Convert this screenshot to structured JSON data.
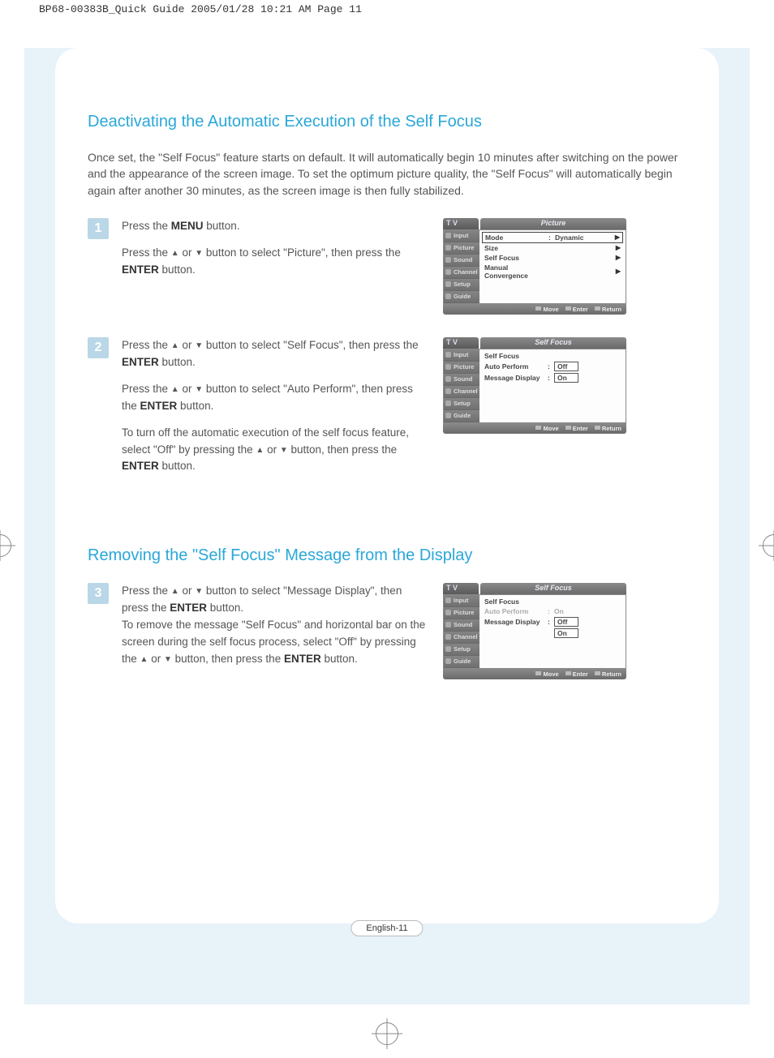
{
  "header": "BP68-00383B_Quick Guide  2005/01/28  10:21 AM  Page 11",
  "page_number": "English-11",
  "section1": {
    "title": "Deactivating the Automatic Execution of the Self Focus",
    "intro": "Once set, the \"Self Focus\" feature starts on default. It will automatically begin 10 minutes after switching on the power and the appearance of the screen image. To set the optimum picture quality, the \"Self Focus\" will automatically begin again after another 30 minutes, as the screen image is then fully stabilized.",
    "steps": [
      {
        "num": "1",
        "paras": [
          "Press the <strong>MENU</strong> button.",
          "Press the <span class='tri'>▲</span> or <span class='tri'>▼</span> button to select \"Picture\", then press the <strong>ENTER</strong> button."
        ]
      },
      {
        "num": "2",
        "paras": [
          "Press the <span class='tri'>▲</span> or <span class='tri'>▼</span> button to select \"Self Focus\", then press the <strong>ENTER</strong> button.",
          "Press the <span class='tri'>▲</span> or <span class='tri'>▼</span> button to select \"Auto Perform\", then press the <strong>ENTER</strong> button.",
          "To turn off the automatic execution of the self focus feature, select \"Off\" by pressing the <span class='tri'>▲</span> or <span class='tri'>▼</span> button, then press the <strong>ENTER</strong> button."
        ]
      }
    ]
  },
  "section2": {
    "title": "Removing the \"Self Focus\" Message from the Display",
    "steps": [
      {
        "num": "3",
        "paras": [
          "Press the <span class='tri'>▲</span> or <span class='tri'>▼</span> button to select \"Message Display\", then press the <strong>ENTER</strong> button.<br>To remove the message \"Self Focus\" and horizontal bar on the screen during the self focus process, select \"Off\" by pressing the <span class='tri'>▲</span> or <span class='tri'>▼</span> button, then press the <strong>ENTER</strong> button."
        ]
      }
    ]
  },
  "osd_side": [
    "Input",
    "Picture",
    "Sound",
    "Channel",
    "Setup",
    "Guide"
  ],
  "osd_foot": {
    "move": "Move",
    "enter": "Enter",
    "ret": "Return"
  },
  "osd1": {
    "tv": "T V",
    "title": "Picture",
    "rows": [
      {
        "label": "Mode",
        "colon": ":",
        "val": "Dynamic",
        "arrow": "▶",
        "sel": true
      },
      {
        "label": "Size",
        "colon": "",
        "val": "",
        "arrow": "▶"
      },
      {
        "label": "Self Focus",
        "colon": "",
        "val": "",
        "arrow": "▶"
      },
      {
        "label": "Manual Convergence",
        "colon": "",
        "val": "",
        "arrow": "▶"
      }
    ]
  },
  "osd2": {
    "tv": "T V",
    "title": "Self Focus",
    "rows": [
      {
        "label": "Self Focus",
        "colon": "",
        "val": ""
      },
      {
        "label": "Auto Perform",
        "colon": ":",
        "val": "Off",
        "boxed": true
      },
      {
        "label": "Message Display",
        "colon": ":",
        "val": "On",
        "boxed": true
      }
    ]
  },
  "osd3": {
    "tv": "T V",
    "title": "Self Focus",
    "rows": [
      {
        "label": "Self Focus",
        "colon": "",
        "val": ""
      },
      {
        "label": "Auto Perform",
        "colon": ":",
        "val": "On",
        "dim": true
      },
      {
        "label": "Message Display",
        "colon": ":",
        "val": "Off",
        "boxed": true
      },
      {
        "label": "",
        "colon": "",
        "val": "On",
        "boxed": true
      }
    ]
  }
}
